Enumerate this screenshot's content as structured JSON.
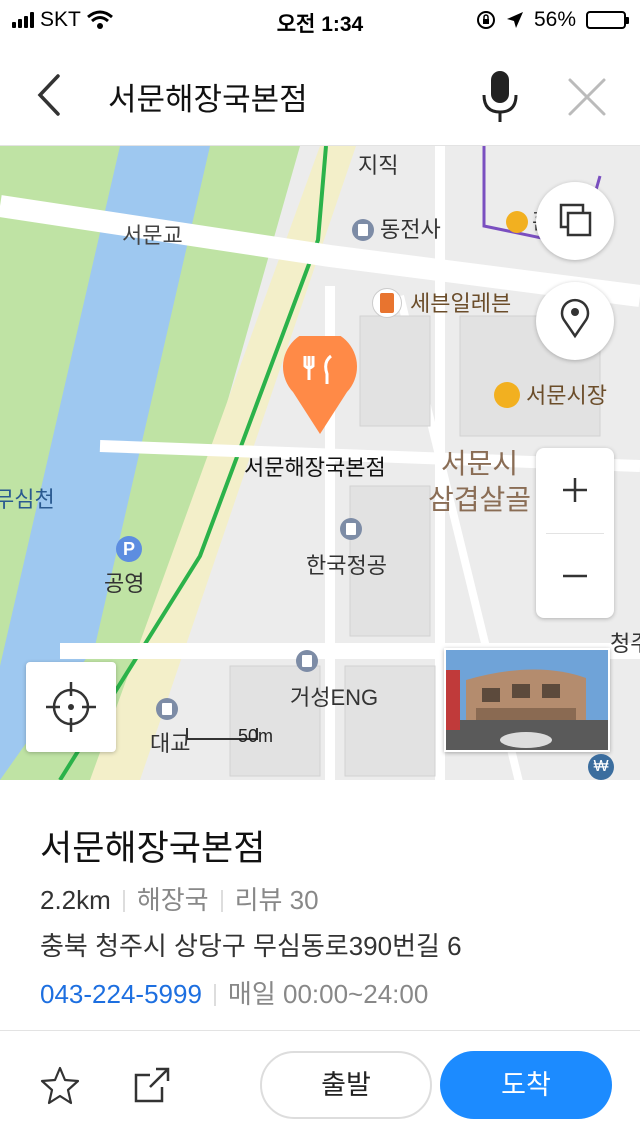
{
  "status": {
    "carrier": "SKT",
    "time": "오전 1:34",
    "battery": "56%",
    "battery_level": 0.56
  },
  "header": {
    "title": "서문해장국본점"
  },
  "map": {
    "labels": {
      "jijik": "지직",
      "dongjeonsa": "동전사",
      "hom": "홈",
      "seomungyo": "서문교",
      "seven": "세븐일레븐",
      "seomun_market": "서문시장",
      "pin_name": "서문해장국본점",
      "samgyeop": "서문시\n삼겹살골",
      "musimcheon": "무심천",
      "gongyeong": "공영",
      "hankook": "한국정공",
      "cheong": "청주",
      "geoseong": "거성ENG",
      "daegyo": "대교",
      "scale": "50m"
    }
  },
  "place": {
    "name": "서문해장국본점",
    "distance": "2.2km",
    "category": "해장국",
    "review": "리뷰 30",
    "address": "충북 청주시 상당구 무심동로390번길 6",
    "phone": "043-224-5999",
    "hours": "매일 00:00~24:00"
  },
  "actions": {
    "depart": "출발",
    "arrive": "도착"
  },
  "colors": {
    "accent": "#1c8bff",
    "pin": "#ff8a47",
    "river": "#9ec8f0",
    "park": "#bfe3a4",
    "route": "#2bb24a"
  }
}
